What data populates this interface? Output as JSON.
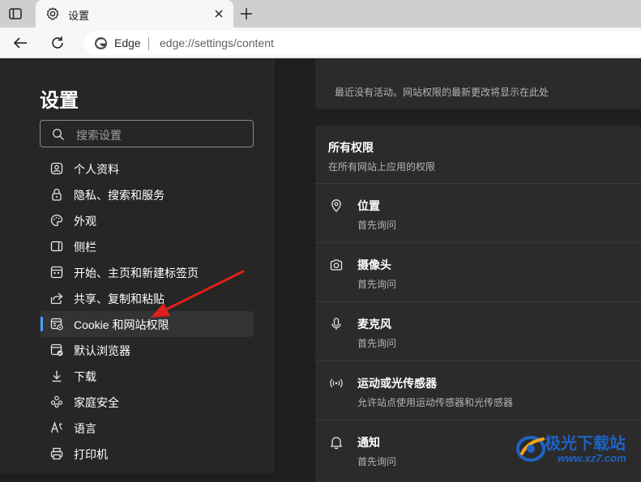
{
  "tab": {
    "title": "设置"
  },
  "address_bar": {
    "site_label": "Edge",
    "url": "edge://settings/content"
  },
  "sidebar": {
    "title": "设置",
    "search_placeholder": "搜索设置",
    "items": [
      {
        "label": "个人资料",
        "icon": "profile-icon"
      },
      {
        "label": "隐私、搜索和服务",
        "icon": "lock-icon"
      },
      {
        "label": "外观",
        "icon": "palette-icon"
      },
      {
        "label": "侧栏",
        "icon": "sidebar-panel-icon"
      },
      {
        "label": "开始、主页和新建标签页",
        "icon": "home-page-icon"
      },
      {
        "label": "共享、复制和粘贴",
        "icon": "share-icon"
      },
      {
        "label": "Cookie 和网站权限",
        "icon": "site-permissions-icon",
        "active": true
      },
      {
        "label": "默认浏览器",
        "icon": "default-browser-icon"
      },
      {
        "label": "下载",
        "icon": "download-icon"
      },
      {
        "label": "家庭安全",
        "icon": "family-icon"
      },
      {
        "label": "语言",
        "icon": "language-icon"
      },
      {
        "label": "打印机",
        "icon": "printer-icon"
      }
    ]
  },
  "main": {
    "recent_activity_text": "最近没有活动。网站权限的最新更改将显示在此处",
    "all_permissions": {
      "title": "所有权限",
      "subtitle": "在所有网站上应用的权限"
    },
    "permissions": [
      {
        "title": "位置",
        "subtitle": "首先询问",
        "icon": "location-icon"
      },
      {
        "title": "摄像头",
        "subtitle": "首先询问",
        "icon": "camera-icon"
      },
      {
        "title": "麦克风",
        "subtitle": "首先询问",
        "icon": "microphone-icon"
      },
      {
        "title": "运动或光传感器",
        "subtitle": "允许站点使用运动传感器和光传感器",
        "icon": "sensor-icon"
      },
      {
        "title": "通知",
        "subtitle": "首先询问",
        "icon": "bell-icon"
      }
    ]
  },
  "watermark": {
    "text": "极光下载站",
    "url": "www.xz7.com"
  },
  "colors": {
    "accent": "#4aa3ff",
    "arrow": "#e0201b",
    "watermark": "#1e63c4"
  }
}
